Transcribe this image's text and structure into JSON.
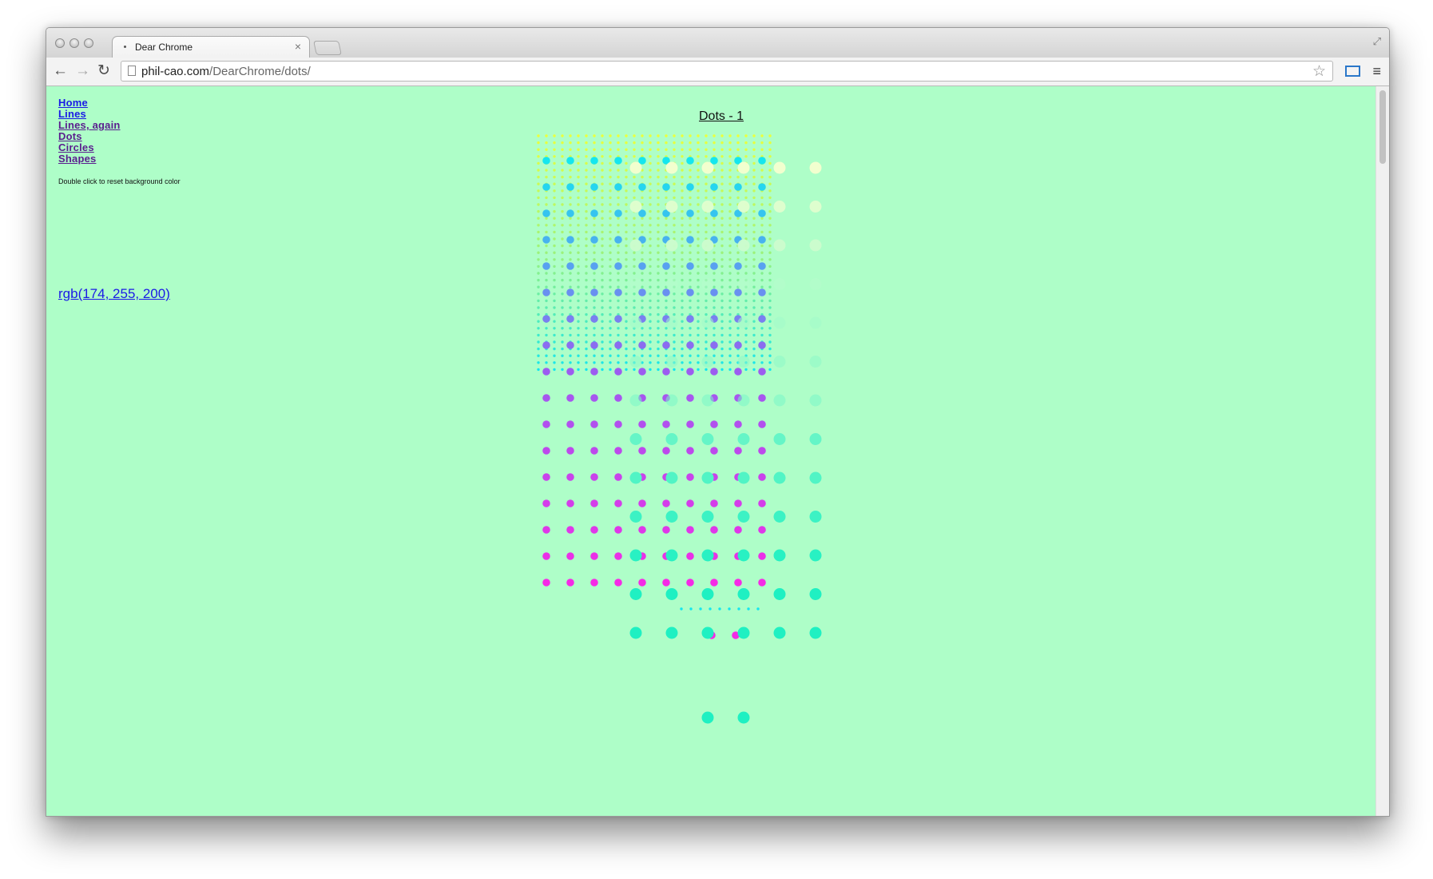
{
  "browser": {
    "tab_title": "Dear Chrome",
    "url_domain": "phil-cao.com",
    "url_path": "/DearChrome/dots/"
  },
  "nav": {
    "links": [
      {
        "label": "Home"
      },
      {
        "label": "Lines"
      },
      {
        "label": "Lines, again"
      },
      {
        "label": "Dots"
      },
      {
        "label": "Circles"
      },
      {
        "label": "Shapes"
      }
    ]
  },
  "hint": "Double click to reset background color",
  "background_label": "rgb(174, 255, 200)",
  "page_title": "Dots - 1",
  "colors": {
    "page_background": "#aefec8",
    "yellow": "#ecff3a",
    "cyan": "#14e6ef",
    "magenta": "#f52ae6",
    "purple": "#9c5cf0",
    "teal": "#1ff0c2",
    "cream": "#f5ffd0",
    "link": "#1a1ae6",
    "visited_link": "#5a1d8e"
  }
}
